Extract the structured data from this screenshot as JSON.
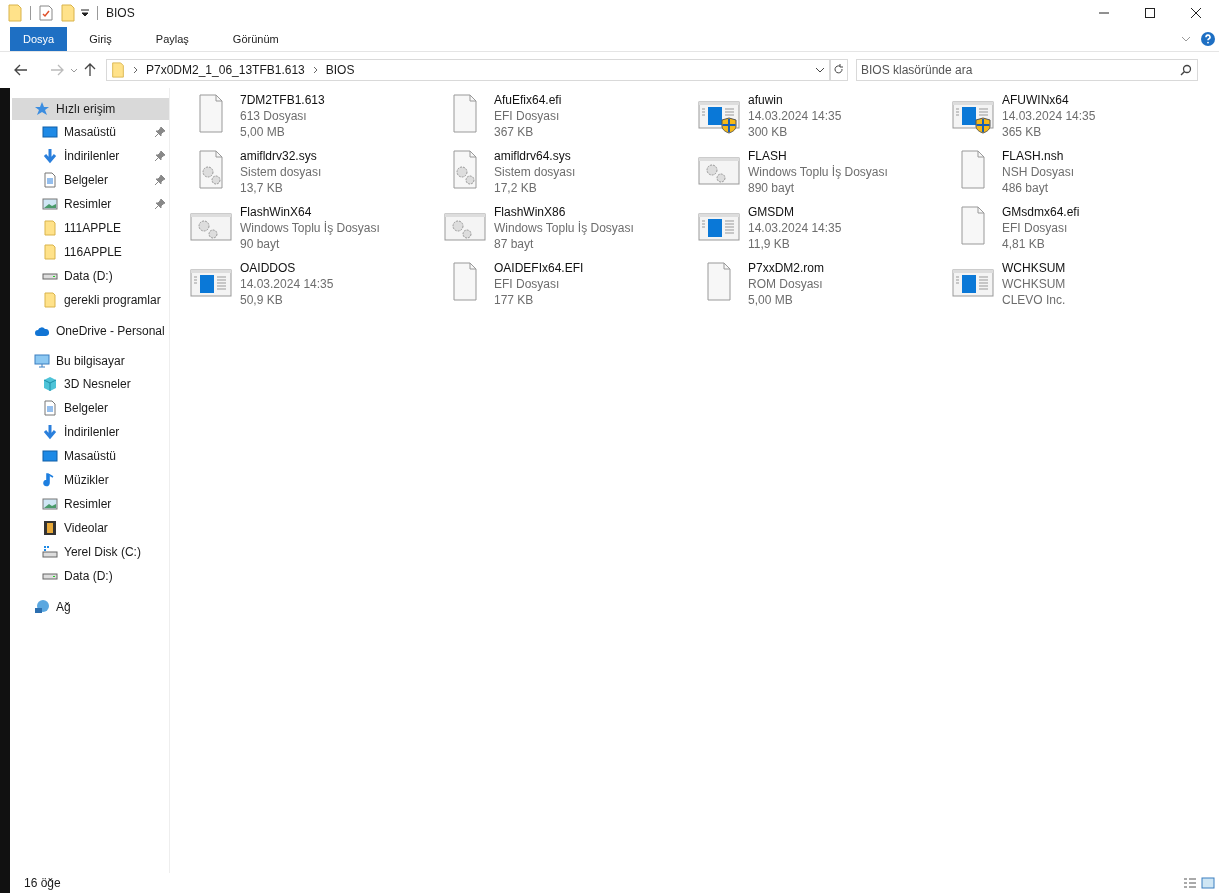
{
  "window": {
    "title": "BIOS"
  },
  "ribbon_tabs": [
    {
      "label": "Dosya",
      "selected": true
    },
    {
      "label": "Giriş",
      "selected": false
    },
    {
      "label": "Paylaş",
      "selected": false
    },
    {
      "label": "Görünüm",
      "selected": false
    }
  ],
  "address": {
    "path": [
      "P7x0DM2_1_06_13TFB1.613",
      "BIOS"
    ]
  },
  "search": {
    "placeholder": "BIOS klasöründe ara"
  },
  "sidebar": {
    "items": [
      {
        "label": "Hızlı erişim",
        "kind": "star",
        "selected": true,
        "children": [
          {
            "label": "Masaüstü",
            "kind": "desktop",
            "pinned": true
          },
          {
            "label": "İndirilenler",
            "kind": "download",
            "pinned": true
          },
          {
            "label": "Belgeler",
            "kind": "document",
            "pinned": true
          },
          {
            "label": "Resimler",
            "kind": "picture",
            "pinned": true
          },
          {
            "label": "111APPLE",
            "kind": "folder",
            "pinned": false
          },
          {
            "label": "116APPLE",
            "kind": "folder",
            "pinned": false
          },
          {
            "label": "Data (D:)",
            "kind": "drive",
            "pinned": false
          },
          {
            "label": "gerekli programlar",
            "kind": "folder",
            "pinned": false
          }
        ]
      },
      {
        "label": "OneDrive - Personal",
        "kind": "cloud",
        "selected": false
      },
      {
        "label": "Bu bilgisayar",
        "kind": "computer",
        "selected": false,
        "children": [
          {
            "label": "3D Nesneler",
            "kind": "cube"
          },
          {
            "label": "Belgeler",
            "kind": "document"
          },
          {
            "label": "İndirilenler",
            "kind": "download"
          },
          {
            "label": "Masaüstü",
            "kind": "desktop"
          },
          {
            "label": "Müzikler",
            "kind": "music"
          },
          {
            "label": "Resimler",
            "kind": "picture"
          },
          {
            "label": "Videolar",
            "kind": "video"
          },
          {
            "label": "Yerel Disk (C:)",
            "kind": "windisk"
          },
          {
            "label": "Data (D:)",
            "kind": "drive"
          }
        ]
      },
      {
        "label": "Ağ",
        "kind": "network",
        "selected": false
      }
    ]
  },
  "files": [
    {
      "name": "7DM2TFB1.613",
      "line_1": "613 Dosyası",
      "line_2": "5,00 MB",
      "kind": "blank"
    },
    {
      "name": "AfuEfix64.efi",
      "line_1": "EFI Dosyası",
      "line_2": "367 KB",
      "kind": "blank"
    },
    {
      "name": "afuwin",
      "line_1": "14.03.2024 14:35",
      "line_2": "300 KB",
      "kind": "shield"
    },
    {
      "name": "AFUWINx64",
      "line_1": "14.03.2024 14:35",
      "line_2": "365 KB",
      "kind": "shield"
    },
    {
      "name": "amifldrv32.sys",
      "line_1": "Sistem dosyası",
      "line_2": "13,7 KB",
      "kind": "system"
    },
    {
      "name": "amifldrv64.sys",
      "line_1": "Sistem dosyası",
      "line_2": "17,2 KB",
      "kind": "system"
    },
    {
      "name": "FLASH",
      "line_1": "Windows Toplu İş Dosyası",
      "line_2": "890 bayt",
      "kind": "batch"
    },
    {
      "name": "FLASH.nsh",
      "line_1": "NSH Dosyası",
      "line_2": "486 bayt",
      "kind": "blank"
    },
    {
      "name": "FlashWinX64",
      "line_1": "Windows Toplu İş Dosyası",
      "line_2": "90 bayt",
      "kind": "batch"
    },
    {
      "name": "FlashWinX86",
      "line_1": "Windows Toplu İş Dosyası",
      "line_2": "87 bayt",
      "kind": "batch"
    },
    {
      "name": "GMSDM",
      "line_1": "14.03.2024 14:35",
      "line_2": "11,9 KB",
      "kind": "app"
    },
    {
      "name": "GMsdmx64.efi",
      "line_1": "EFI Dosyası",
      "line_2": "4,81 KB",
      "kind": "blank"
    },
    {
      "name": "OAIDDOS",
      "line_1": "14.03.2024 14:35",
      "line_2": "50,9 KB",
      "kind": "app"
    },
    {
      "name": "OAIDEFIx64.EFI",
      "line_1": "EFI Dosyası",
      "line_2": "177 KB",
      "kind": "blank"
    },
    {
      "name": "P7xxDM2.rom",
      "line_1": "ROM Dosyası",
      "line_2": "5,00 MB",
      "kind": "blank"
    },
    {
      "name": "WCHKSUM",
      "line_1": "WCHKSUM",
      "line_2": "CLEVO Inc.",
      "kind": "app"
    }
  ],
  "status_bar": {
    "item_count": "16 öğe"
  }
}
